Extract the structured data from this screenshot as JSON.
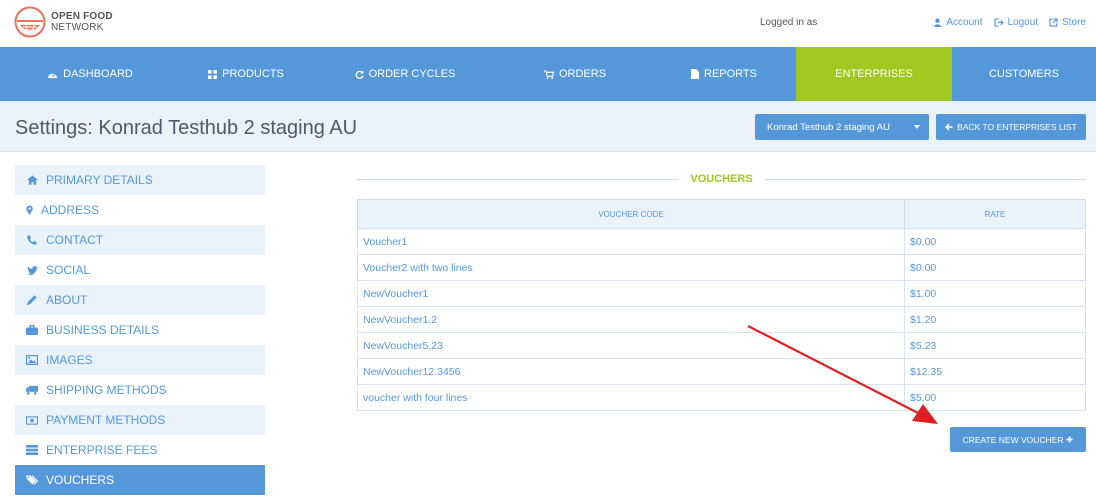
{
  "brand": {
    "line1": "OPEN FOOD",
    "line2": "NETWORK"
  },
  "header": {
    "logged_in": "Logged in as",
    "links": [
      {
        "icon": "user-icon",
        "label": "Account"
      },
      {
        "icon": "logout-icon",
        "label": "Logout"
      },
      {
        "icon": "external-link-icon",
        "label": "Store"
      }
    ]
  },
  "nav": [
    {
      "icon": "dashboard-icon",
      "label": "DASHBOARD"
    },
    {
      "icon": "grid-icon",
      "label": "PRODUCTS"
    },
    {
      "icon": "refresh-icon",
      "label": "ORDER CYCLES"
    },
    {
      "icon": "cart-icon",
      "label": "ORDERS"
    },
    {
      "icon": "file-icon",
      "label": "REPORTS"
    },
    {
      "icon": "",
      "label": "ENTERPRISES"
    },
    {
      "icon": "",
      "label": "CUSTOMERS"
    }
  ],
  "page": {
    "title": "Settings: Konrad Testhub 2 staging AU",
    "enterprise_select": "Konrad Testhub 2 staging AU",
    "back_button": "BACK TO ENTERPRISES LIST"
  },
  "sidebar": [
    {
      "icon": "home-icon",
      "label": "PRIMARY DETAILS"
    },
    {
      "icon": "map-marker-icon",
      "label": "ADDRESS"
    },
    {
      "icon": "phone-icon",
      "label": "CONTACT"
    },
    {
      "icon": "twitter-icon",
      "label": "SOCIAL"
    },
    {
      "icon": "pencil-icon",
      "label": "ABOUT"
    },
    {
      "icon": "briefcase-icon",
      "label": "BUSINESS DETAILS"
    },
    {
      "icon": "picture-icon",
      "label": "IMAGES"
    },
    {
      "icon": "truck-icon",
      "label": "SHIPPING METHODS"
    },
    {
      "icon": "money-icon",
      "label": "PAYMENT METHODS"
    },
    {
      "icon": "fees-icon",
      "label": "ENTERPRISE FEES"
    },
    {
      "icon": "tags-icon",
      "label": "VOUCHERS"
    }
  ],
  "vouchers": {
    "title": "VOUCHERS",
    "columns": [
      "VOUCHER CODE",
      "RATE"
    ],
    "rows": [
      {
        "code": "Voucher1",
        "rate": "$0.00"
      },
      {
        "code": "Voucher2 with two lines",
        "rate": "$0.00"
      },
      {
        "code": "NewVoucher1",
        "rate": "$1.00"
      },
      {
        "code": "NewVoucher1.2",
        "rate": "$1.20"
      },
      {
        "code": "NewVoucher5.23",
        "rate": "$5.23"
      },
      {
        "code": "NewVoucher12.3456",
        "rate": "$12.35"
      },
      {
        "code": "voucher with four lines",
        "rate": "$5.00"
      }
    ],
    "create_button": "CREATE NEW VOUCHER"
  },
  "colors": {
    "primary": "#5498da",
    "accent": "#9fc820",
    "light": "#eaf2fb",
    "arrow": "#e02020"
  }
}
